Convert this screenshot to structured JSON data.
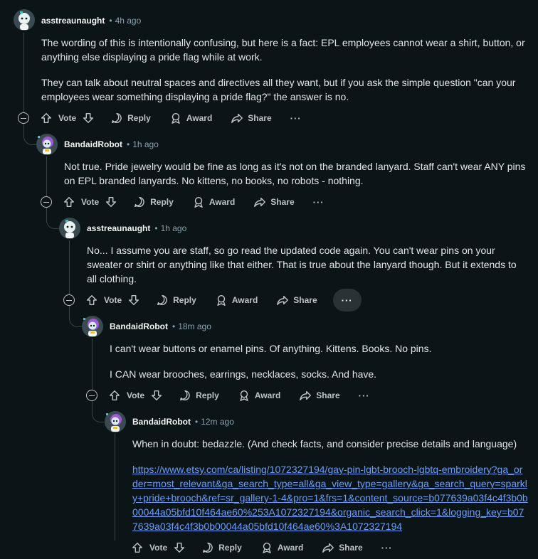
{
  "actions": {
    "vote": "Vote",
    "reply": "Reply",
    "award": "Award",
    "share": "Share",
    "more": "···"
  },
  "comments": [
    {
      "user": "asstreaunaught",
      "time": "4h ago",
      "paragraphs": [
        "The wording of this is intentionally confusing, but here is a fact: EPL employees cannot wear a shirt, button, or anything else displaying a pride flag while at work.",
        "They can talk about neutral spaces and directives all they want, but if you ask the simple question \"can your employees wear something displaying a pride flag?\" the answer is no."
      ]
    },
    {
      "user": "BandaidRobot",
      "time": "1h ago",
      "paragraphs": [
        "Not true. Pride jewelry would be fine as long as it's not on the branded lanyard. Staff can't wear ANY pins on EPL branded lanyards. No kittens, no books, no robots - nothing."
      ]
    },
    {
      "user": "asstreaunaught",
      "time": "1h ago",
      "paragraphs": [
        "No... I assume you are staff, so go read the updated code again. You can't wear pins on your sweater or shirt or anything like that either. That is true about the lanyard though. But it extends to all clothing."
      ]
    },
    {
      "user": "BandaidRobot",
      "time": "18m ago",
      "paragraphs": [
        "I can't wear buttons or enamel pins. Of anything. Kittens. Books. No pins.",
        "I CAN wear brooches, earrings, necklaces, socks. And have."
      ]
    },
    {
      "user": "BandaidRobot",
      "time": "12m ago",
      "paragraphs": [
        "When in doubt: bedazzle. (And check facts, and consider precise details and language)"
      ],
      "link": "https://www.etsy.com/ca/listing/1072327194/gay-pin-lgbt-brooch-lgbtq-embroidery?ga_order=most_relevant&ga_search_type=all&ga_view_type=gallery&ga_search_query=sparkly+pride+brooch&ref=sr_gallery-1-4&pro=1&frs=1&content_source=b077639a03f4c4f3b0b00044a05bfd10f464ae60%253A1072327194&organic_search_click=1&logging_key=b077639a03f4c4f3b0b00044a05bfd10f464ae60%3A1072327194"
    }
  ],
  "colors": {
    "background": "#0b1416",
    "text": "#e3e6e8",
    "meta": "#8ba2ad",
    "link": "#6b9ef7",
    "thread_line": "#33464c"
  }
}
